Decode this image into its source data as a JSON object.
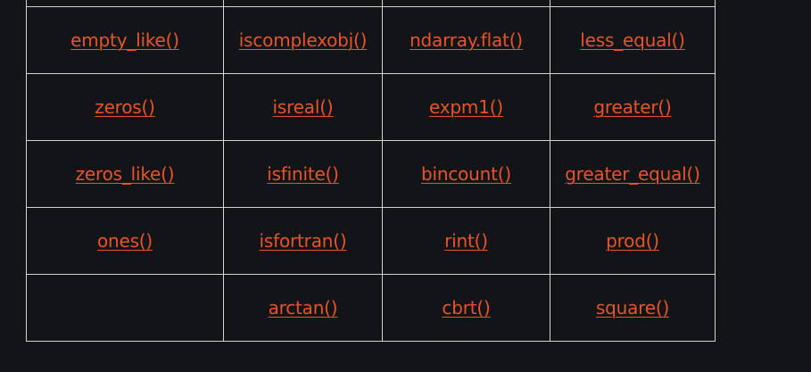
{
  "colors": {
    "background": "#131417",
    "link": "#e8542a",
    "border": "#d4d4d4"
  },
  "table": {
    "rows": [
      [
        "",
        "",
        "",
        ""
      ],
      [
        "empty_like()",
        "iscomplexobj()",
        "ndarray.flat()",
        "less_equal()"
      ],
      [
        "zeros()",
        "isreal()",
        "expm1()",
        "greater()"
      ],
      [
        "zeros_like()",
        "isfinite()",
        "bincount()",
        "greater_equal()"
      ],
      [
        "ones()",
        "isfortran()",
        "rint()",
        "prod()"
      ],
      [
        "",
        "arctan()",
        "cbrt()",
        "square()"
      ]
    ]
  }
}
